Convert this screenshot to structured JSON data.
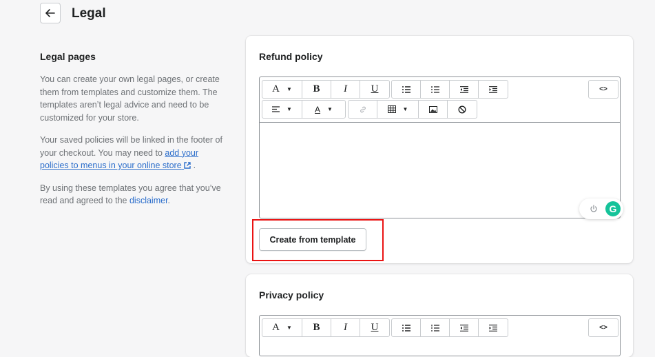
{
  "header": {
    "title": "Legal",
    "back_icon": "arrow-left-icon"
  },
  "aside": {
    "title": "Legal pages",
    "p1": "You can create your own legal pages, or create them from templates and customize them. The templates aren’t legal advice and need to be customized for your store.",
    "p2_text": "Your saved policies will be linked in the footer of your checkout. You may need to ",
    "p2_link": "add your policies to menus in your online store",
    "p2_end": " .",
    "p3_text": "By using these templates you agree that you’ve read and agreed to the ",
    "p3_link": "disclaimer",
    "p3_end": "."
  },
  "refund": {
    "title": "Refund policy",
    "template_button": "Create from template"
  },
  "privacy": {
    "title": "Privacy policy"
  },
  "toolbar": {
    "font": "A",
    "bold": "B",
    "italic": "I",
    "underline": "U",
    "color": "A",
    "html": "<>",
    "icons": [
      "bulleted-list-icon",
      "numbered-list-icon",
      "outdent-icon",
      "indent-icon",
      "align-icon",
      "link-icon",
      "table-icon",
      "image-icon",
      "clear-format-icon",
      "code-icon"
    ]
  },
  "grammarly": {
    "logo": "G"
  },
  "colors": {
    "link": "#2c6ecb",
    "highlight": "#ea1313",
    "grammarly": "#15c39a"
  }
}
